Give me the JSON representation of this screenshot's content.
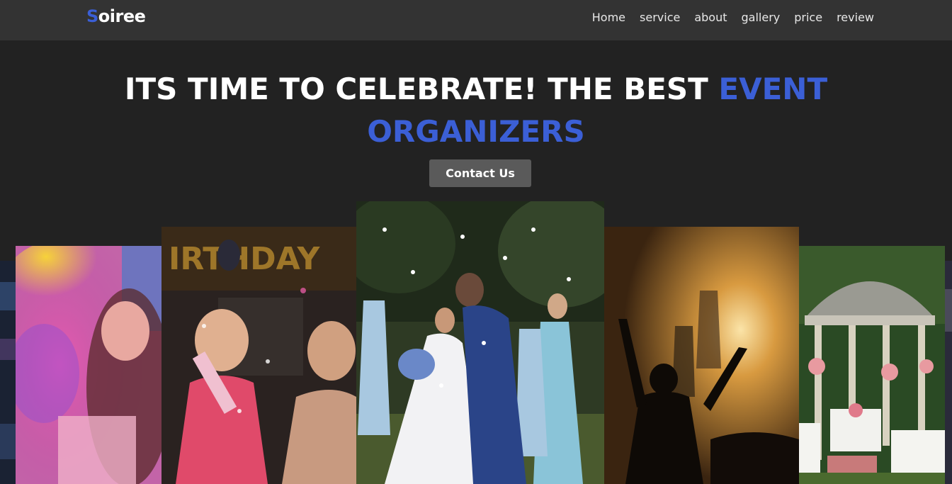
{
  "brand": {
    "first_letter": "S",
    "rest": "oiree"
  },
  "nav": {
    "items": [
      "Home",
      "service",
      "about",
      "gallery",
      "price",
      "review"
    ]
  },
  "hero": {
    "title_main": "ITS TIME TO CELEBRATE! THE BEST ",
    "title_accent_1": "EVENT",
    "title_accent_2": "ORGANIZERS",
    "cta_label": "Contact Us"
  },
  "colors": {
    "accent": "#3b5fd6",
    "background": "#222222",
    "navbar": "#333333",
    "button": "#5a5a5a"
  },
  "gallery": {
    "photos": [
      {
        "name": "concert-left-edge-photo"
      },
      {
        "name": "holi-color-photo"
      },
      {
        "name": "birthday-party-photo"
      },
      {
        "name": "wedding-photo"
      },
      {
        "name": "concert-crowd-photo"
      },
      {
        "name": "gazebo-venue-photo"
      },
      {
        "name": "right-edge-photo"
      }
    ]
  }
}
